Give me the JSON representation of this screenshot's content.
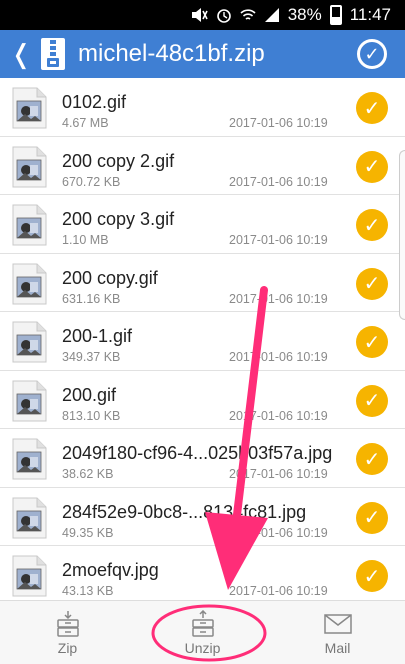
{
  "status_bar": {
    "battery": "38%",
    "time": "11:47"
  },
  "app_bar": {
    "title": "michel-48c1bf.zip"
  },
  "files": [
    {
      "name": "0102.gif",
      "size": "4.67 MB",
      "date": "2017-01-06 10:19"
    },
    {
      "name": "200 copy 2.gif",
      "size": "670.72 KB",
      "date": "2017-01-06 10:19"
    },
    {
      "name": "200 copy 3.gif",
      "size": "1.10 MB",
      "date": "2017-01-06 10:19"
    },
    {
      "name": "200 copy.gif",
      "size": "631.16 KB",
      "date": "2017-01-06 10:19"
    },
    {
      "name": "200-1.gif",
      "size": "349.37 KB",
      "date": "2017-01-06 10:19"
    },
    {
      "name": "200.gif",
      "size": "813.10 KB",
      "date": "2017-01-06 10:19"
    },
    {
      "name": "2049f180-cf96-4...025b03f57a.jpg",
      "size": "38.62 KB",
      "date": "2017-01-06 10:19"
    },
    {
      "name": "284f52e9-0bc8-...8134fc81.jpg",
      "size": "49.35 KB",
      "date": "2017-01-06 10:19"
    },
    {
      "name": "2moefqv.jpg",
      "size": "43.13 KB",
      "date": "2017-01-06 10:19"
    }
  ],
  "bottom_bar": {
    "zip_label": "Zip",
    "unzip_label": "Unzip",
    "mail_label": "Mail"
  },
  "colors": {
    "app_bar": "#3f7fd3",
    "check_badge": "#f6b400",
    "annotation": "#ff2d78"
  }
}
